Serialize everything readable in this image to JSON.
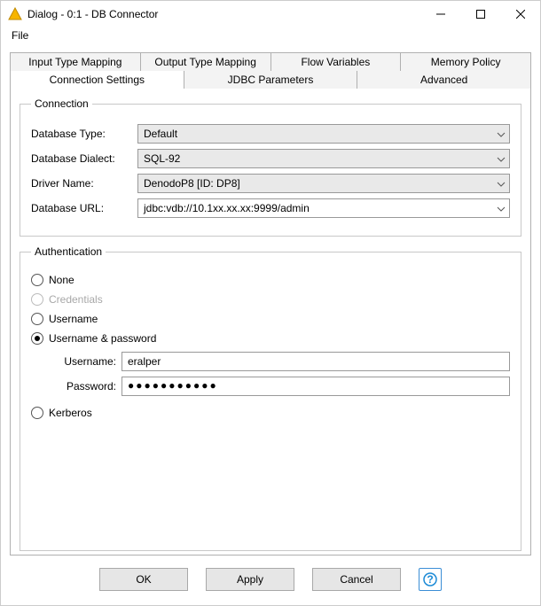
{
  "window": {
    "title": "Dialog - 0:1 - DB Connector"
  },
  "menubar": {
    "file": "File"
  },
  "tabs": {
    "row1": {
      "input_type_mapping": "Input Type Mapping",
      "output_type_mapping": "Output Type Mapping",
      "flow_variables": "Flow Variables",
      "memory_policy": "Memory Policy"
    },
    "row2": {
      "connection_settings": "Connection Settings",
      "jdbc_parameters": "JDBC Parameters",
      "advanced": "Advanced"
    }
  },
  "connection": {
    "legend": "Connection",
    "db_type_label": "Database Type:",
    "db_type_value": "Default",
    "dialect_label": "Database Dialect:",
    "dialect_value": "SQL-92",
    "driver_label": "Driver Name:",
    "driver_value": "DenodoP8 [ID: DP8]",
    "url_label": "Database URL:",
    "url_value": "jdbc:vdb://10.1xx.xx.xx:9999/admin"
  },
  "auth": {
    "legend": "Authentication",
    "none": "None",
    "credentials": "Credentials",
    "username_only": "Username",
    "username_password": "Username & password",
    "username_label": "Username:",
    "username_value": "eralper",
    "password_label": "Password:",
    "password_value": "●●●●●●●●●●●",
    "kerberos": "Kerberos"
  },
  "buttons": {
    "ok": "OK",
    "apply": "Apply",
    "cancel": "Cancel",
    "help": "?"
  }
}
